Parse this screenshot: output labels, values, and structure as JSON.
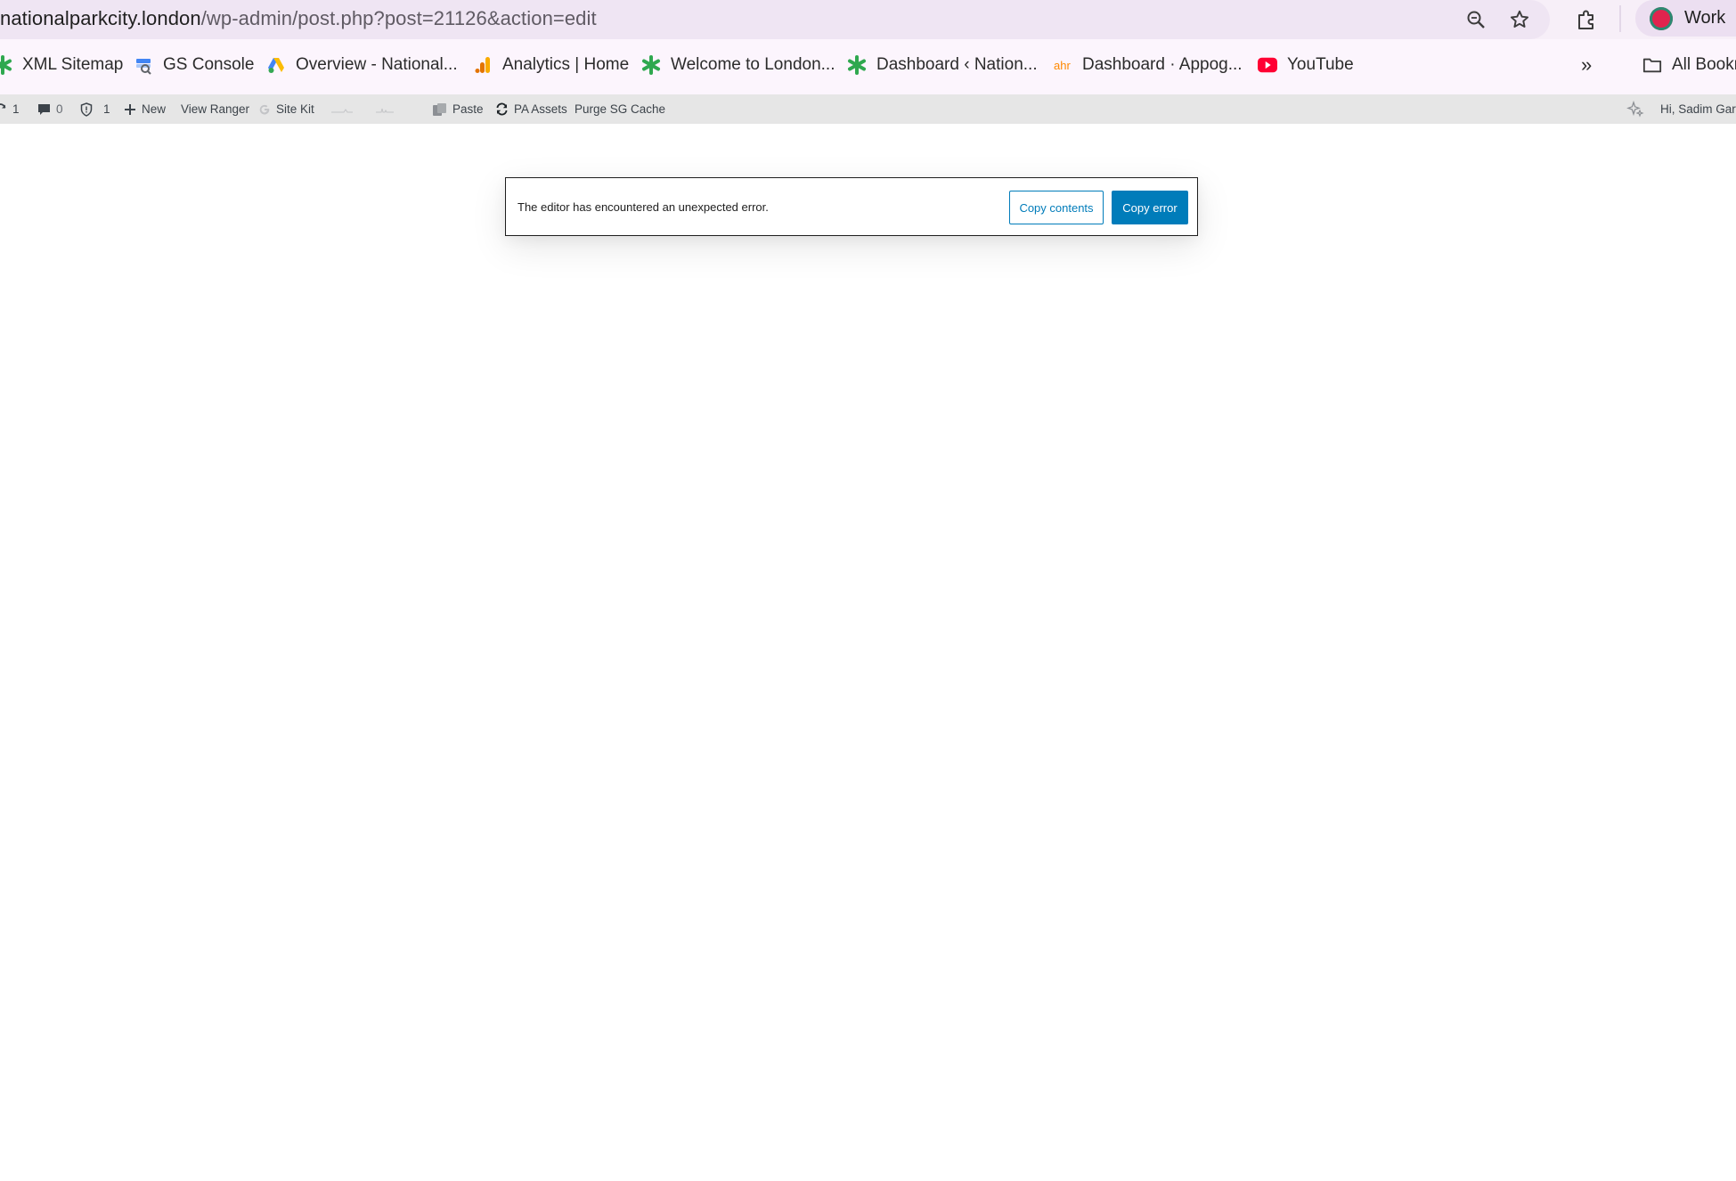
{
  "browser": {
    "url_host": "nationalparkcity.london",
    "url_path": "/wp-admin/post.php?post=21126&action=edit",
    "icons": [
      "zoom-icon",
      "bookmark-star-icon",
      "extensions-icon"
    ],
    "profile_label": "Work"
  },
  "bookmarks": {
    "items": [
      {
        "label": "XML Sitemap",
        "icon": "green-asterisk-icon"
      },
      {
        "label": "GS Console",
        "icon": "search-console-icon"
      },
      {
        "label": "Overview - National...",
        "icon": "google-ads-icon"
      },
      {
        "label": "Analytics | Home",
        "icon": "analytics-icon"
      },
      {
        "label": "Welcome to London...",
        "icon": "green-asterisk-icon"
      },
      {
        "label": "Dashboard ‹ Nation...",
        "icon": "green-asterisk-icon"
      },
      {
        "label": "Dashboard · Appog...",
        "icon": "ahrefs-icon"
      },
      {
        "label": "YouTube",
        "icon": "youtube-icon"
      }
    ],
    "overflow_label": "»",
    "all_bookmarks_label": "All Bookm"
  },
  "admin_bar": {
    "updates_count": "1",
    "comments_count": "0",
    "security_count": "1",
    "new_label": "New",
    "view_ranger_label": "View Ranger",
    "site_kit_label": "Site Kit",
    "paste_label": "Paste",
    "pa_assets_label": "PA Assets",
    "purge_label": "Purge SG Cache",
    "greeting": "Hi, Sadim Garv"
  },
  "notice": {
    "message": "The editor has encountered an unexpected error.",
    "copy_contents_label": "Copy contents",
    "copy_error_label": "Copy error"
  },
  "colors": {
    "wp_blue": "#007cba",
    "admin_bar_bg": "#e6e6e6",
    "omnibox_bg": "#efe5f3"
  }
}
